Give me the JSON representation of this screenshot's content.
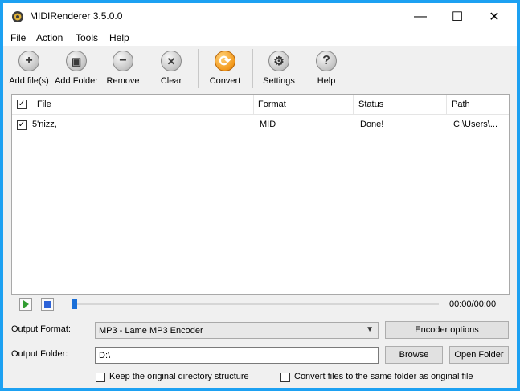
{
  "app": {
    "title": "MIDIRenderer 3.5.0.0"
  },
  "window_controls": {
    "minimize": "—",
    "maximize": "☐",
    "close": "✕"
  },
  "menu": [
    "File",
    "Action",
    "Tools",
    "Help"
  ],
  "toolbar": [
    {
      "label": "Add file(s)",
      "icon": "add-icon",
      "glyph": "+"
    },
    {
      "label": "Add Folder",
      "icon": "add-folder-icon",
      "glyph": "▣"
    },
    {
      "label": "Remove",
      "icon": "remove-icon",
      "glyph": "−"
    },
    {
      "label": "Clear",
      "icon": "clear-icon",
      "glyph": "✕"
    },
    {
      "label": "Convert",
      "icon": "convert-icon",
      "glyph": "⟳"
    },
    {
      "label": "Settings",
      "icon": "settings-icon",
      "glyph": "⚙"
    },
    {
      "label": "Help",
      "icon": "help-icon",
      "glyph": "?"
    }
  ],
  "file_list": {
    "columns": [
      "File",
      "Format",
      "Status",
      "Path"
    ],
    "rows": [
      {
        "checked": true,
        "file": "5'nizz,",
        "format": "MID",
        "status": "Done!",
        "path": "C:\\Users\\..."
      }
    ]
  },
  "player": {
    "time": "00:00/00:00",
    "progress": 0
  },
  "output": {
    "format_label": "Output Format:",
    "format_value": "MP3 - Lame MP3 Encoder",
    "encoder_options": "Encoder options",
    "folder_label": "Output Folder:",
    "folder_value": "D:\\",
    "browse": "Browse",
    "open_folder": "Open Folder",
    "keep_structure": "Keep the original directory structure",
    "same_folder": "Convert files to the same folder as original file"
  },
  "colors": {
    "frame": "#1da1f2",
    "convert_icon": "#f39a1d",
    "play_icon": "#2e9b2e",
    "stop_icon": "#2d63d8"
  }
}
